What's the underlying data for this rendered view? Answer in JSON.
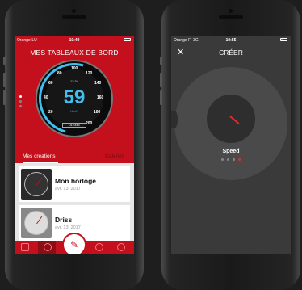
{
  "left_phone": {
    "status": {
      "carrier": "Orange-LU",
      "time": "10:49"
    },
    "header": {
      "title": "MES TABLEAUX DE BORD"
    },
    "gauge": {
      "speed": "59",
      "unit": "Km/h",
      "clock": "12:34",
      "odometer": "012345",
      "ticks": [
        "20",
        "40",
        "60",
        "80",
        "100",
        "120",
        "140",
        "160",
        "180",
        "200"
      ]
    },
    "tabs": {
      "mine": "Mes créations",
      "other": "Galeries"
    },
    "dashboards": [
      {
        "name": "Mon horloge",
        "date": "avr. 13, 2017"
      },
      {
        "name": "Driss",
        "date": "avr. 13, 2017"
      }
    ],
    "icons": [
      "home-icon",
      "gear-icon",
      "brush-icon",
      "user-icon",
      "settings-icon"
    ]
  },
  "right_phone": {
    "status": {
      "carrier": "Orange F",
      "network": "3G",
      "time": "10:55"
    },
    "header": {
      "title": "CRÉER",
      "close_label": "✕"
    },
    "widget": {
      "label": "Speed"
    }
  },
  "colors": {
    "primary": "#c4101c",
    "accent": "#3ec0f0",
    "dark": "#3a3a3a"
  }
}
